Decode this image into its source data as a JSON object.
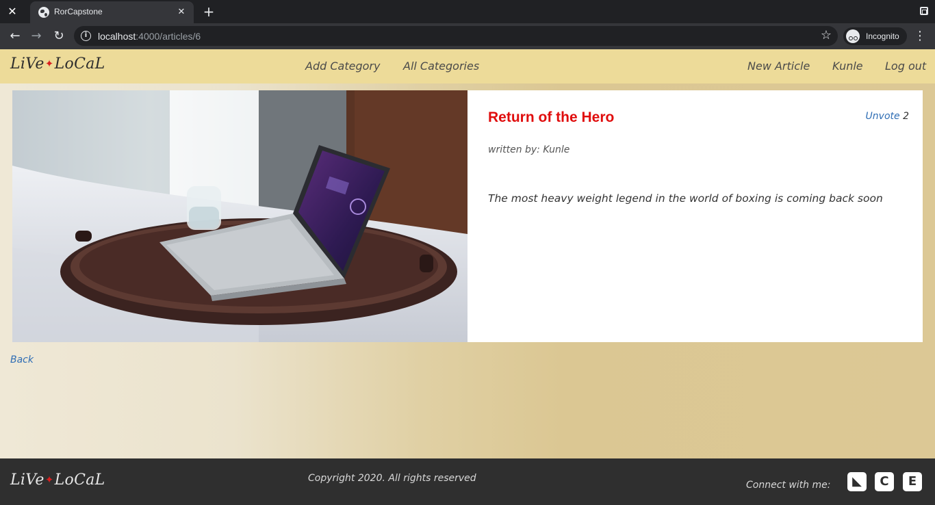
{
  "browser": {
    "tab_title": "RorCapstone",
    "url_host": "localhost",
    "url_path": ":4000/articles/6",
    "profile_label": "Incognito"
  },
  "navbar": {
    "brand_left": "LiVe",
    "brand_star": "✦",
    "brand_right": "LoCaL",
    "add_category": "Add Category",
    "all_categories": "All Categories",
    "new_article": "New Article",
    "user": "Kunle",
    "logout": "Log out"
  },
  "article": {
    "title": "Return of the Hero",
    "vote_label": "Unvote",
    "vote_count": "2",
    "author_line": "written by: Kunle",
    "text": "The most heavy weight legend in the world of boxing is coming back soon"
  },
  "page": {
    "back_label": "Back"
  },
  "footer": {
    "brand_left": "LiVe",
    "brand_star": "✦",
    "brand_right": "LoCaL",
    "copyright": "Copyright 2020. All rights reserved",
    "connect_label": "Connect with me:",
    "social": [
      {
        "icon": "angellist-icon",
        "glyph": "◣"
      },
      {
        "icon": "codepen-icon",
        "glyph": "C"
      },
      {
        "icon": "envato-icon",
        "glyph": "E"
      }
    ]
  },
  "colors": {
    "navbar_bg": "#eddb99",
    "title_red": "#e00d0d",
    "link_blue": "#2e6db4",
    "footer_bg": "#2f2f2f"
  }
}
